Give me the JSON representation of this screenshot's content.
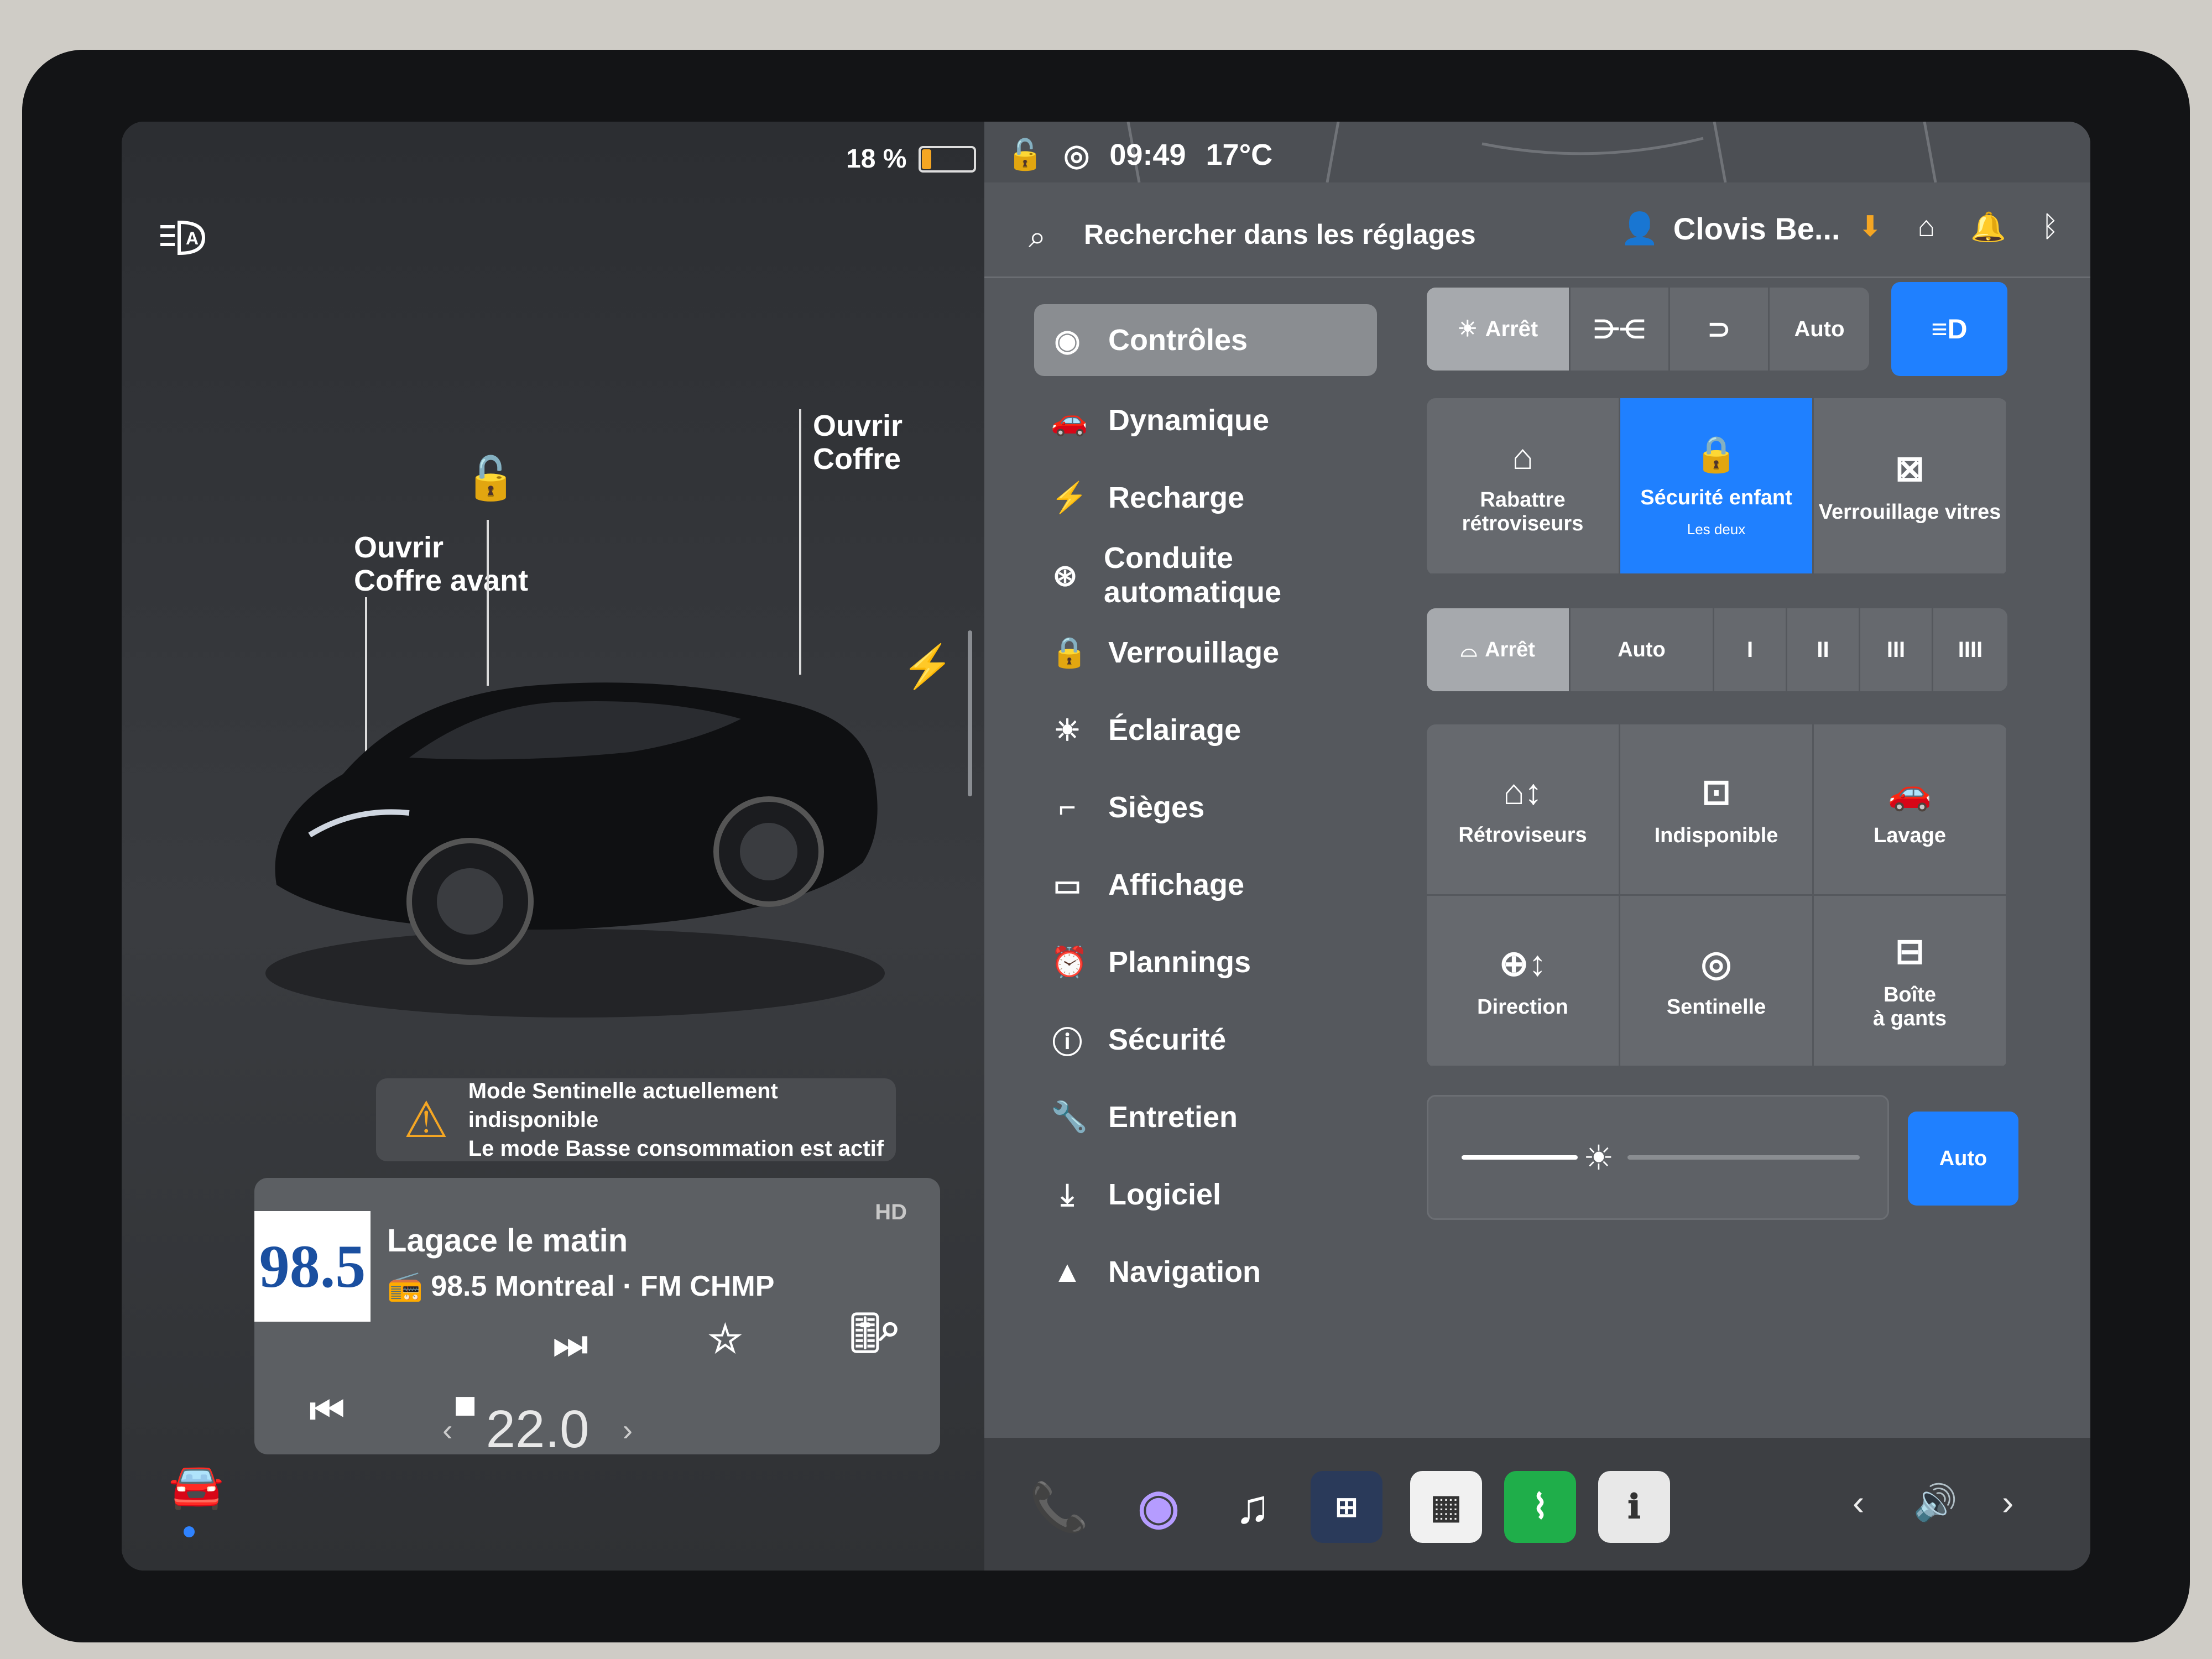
{
  "status": {
    "battery_percent": "18 %",
    "battery_level": 0.18,
    "time": "09:49",
    "temperature": "17°C"
  },
  "car_view": {
    "auto_headlights_icon": "auto-headlight-icon",
    "front_trunk_label": "Ouvrir\nCoffre avant",
    "trunk_label": "Ouvrir\nCoffre",
    "lock_icon": "unlock-icon",
    "charge_icon": "bolt-icon"
  },
  "sentinel_notice": {
    "line1": "Mode Sentinelle actuellement indisponible",
    "line2": "Le mode Basse consommation est actif"
  },
  "media": {
    "station_logo": "98.5",
    "title": "Lagace le matin",
    "subtitle": "98.5 Montreal · FM CHMP",
    "hd_badge": "HD"
  },
  "climate": {
    "temperature": "22.0",
    "prev": "‹",
    "next": "›"
  },
  "settings": {
    "search_placeholder": "Rechercher dans les réglages",
    "profile_name": "Clovis Be...",
    "sidebar": [
      {
        "label": "Contrôles",
        "icon": "toggle-icon"
      },
      {
        "label": "Dynamique",
        "icon": "car-icon"
      },
      {
        "label": "Recharge",
        "icon": "bolt-icon"
      },
      {
        "label": "Conduite automatique",
        "icon": "steering-wheel-icon"
      },
      {
        "label": "Verrouillage",
        "icon": "lock-icon"
      },
      {
        "label": "Éclairage",
        "icon": "sun-icon"
      },
      {
        "label": "Sièges",
        "icon": "seat-icon"
      },
      {
        "label": "Affichage",
        "icon": "display-icon"
      },
      {
        "label": "Plannings",
        "icon": "alarm-icon"
      },
      {
        "label": "Sécurité",
        "icon": "info-circle-icon"
      },
      {
        "label": "Entretien",
        "icon": "wrench-icon"
      },
      {
        "label": "Logiciel",
        "icon": "download-icon"
      },
      {
        "label": "Navigation",
        "icon": "navigation-icon"
      }
    ],
    "headlights": {
      "off": "Arrêt",
      "auto": "Auto"
    },
    "controls_row1": {
      "fold_mirrors": "Rabattre rétroviseurs",
      "child_lock": "Sécurité enfant",
      "child_lock_sub": "Les deux",
      "window_lock": "Verrouillage vitres"
    },
    "wipers": {
      "off": "Arrêt",
      "auto": "Auto",
      "levels": [
        "I",
        "II",
        "III",
        "IIII"
      ]
    },
    "controls_grid": {
      "mirrors": "Rétroviseurs",
      "steering": "Direction",
      "unavailable": "Indisponible",
      "sentinel": "Sentinelle",
      "wash": "Lavage",
      "glovebox": "Boîte\nà gants"
    },
    "brightness": {
      "auto": "Auto",
      "level": 0.35
    }
  },
  "colors": {
    "accent_blue": "#1f80ff",
    "warning": "#f5a623",
    "phone_green": "#2ecc40"
  }
}
